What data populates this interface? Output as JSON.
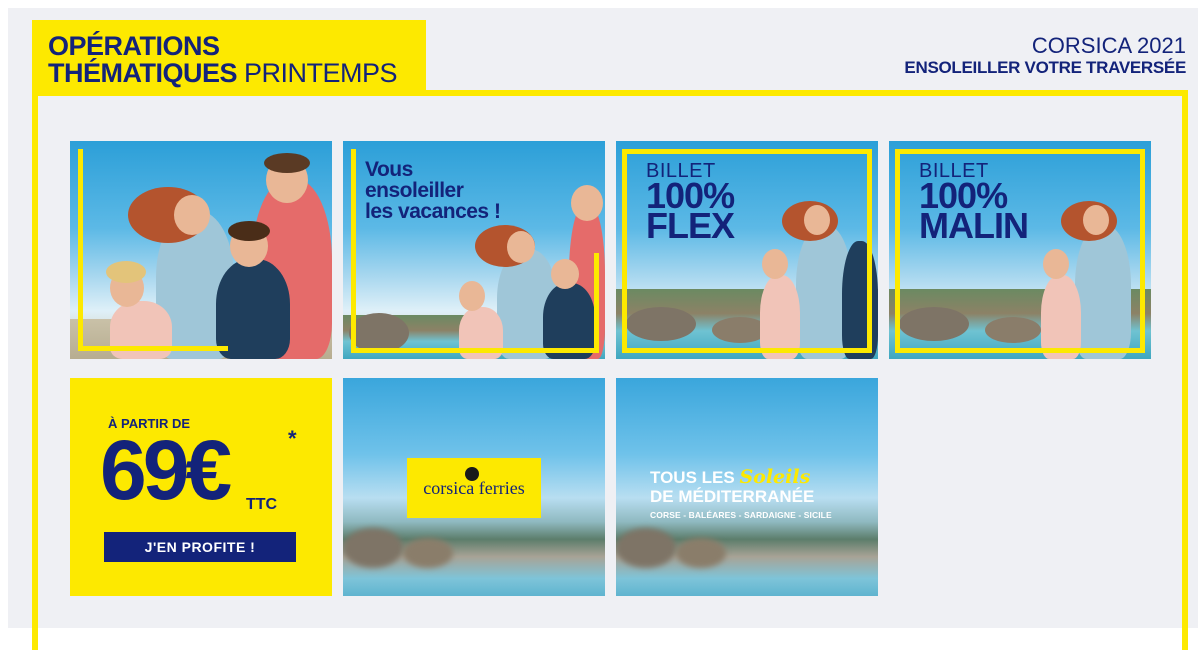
{
  "header": {
    "title_line1": "OPÉRATIONS",
    "title_line2_bold": "THÉMATIQUES",
    "title_line2_light": "PRINTEMPS"
  },
  "corner": {
    "line1": "CORSICA 2021",
    "line2": "ENSOLEILLER VOTRE TRAVERSÉE"
  },
  "tiles": {
    "t2": {
      "line1": "Vous",
      "line2": "ensoleiller",
      "line3": "les vacances !"
    },
    "t3": {
      "line1": "BILLET",
      "line2": "100%",
      "line3": "FLEX"
    },
    "t4": {
      "line1": "BILLET",
      "line2": "100%",
      "line3": "MALIN"
    },
    "t5": {
      "from_label": "À PARTIR DE",
      "price": "69€",
      "asterisk": "*",
      "ttc": "TTC",
      "cta": "J'EN PROFITE !"
    },
    "t6": {
      "brand": "corsica ferries"
    },
    "t7": {
      "line1": "TOUS LES",
      "script": "Soleils",
      "line2": "DE MÉDITERRANÉE",
      "line3": "CORSE - BALÉARES - SARDAIGNE - SICILE"
    }
  },
  "colors": {
    "brand_yellow": "#fde900",
    "brand_navy": "#13237a",
    "canvas": "#eff0f4"
  }
}
